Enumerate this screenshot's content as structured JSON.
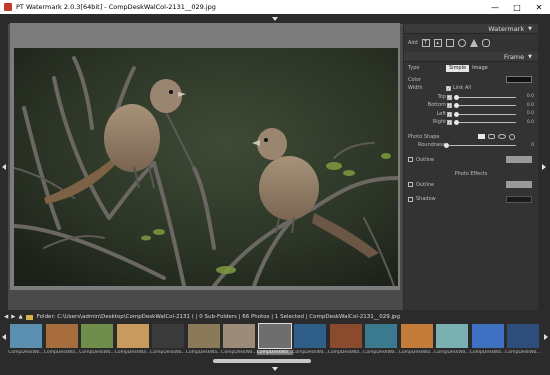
{
  "window": {
    "title": "PT Watermark 2.0.3[64bit] - CompDeskWalCol-2131__029.jpg",
    "controls": [
      "minimize-icon",
      "maximize-icon",
      "close-icon"
    ]
  },
  "panel": {
    "watermark_header": "Watermark",
    "add_label": "Add",
    "add_tools": [
      "text-tool-icon",
      "image-tool-icon",
      "rect-tool-icon",
      "circle-tool-icon",
      "triangle-tool-icon",
      "polygon-tool-icon"
    ],
    "frame_header": "Frame",
    "type_label": "Type",
    "type_simple": "Simple",
    "type_image": "Image",
    "color_label": "Color",
    "width_label": "Width",
    "link_all_label": "Link All",
    "sides": [
      {
        "label": "Top",
        "value": "0.0"
      },
      {
        "label": "Bottom",
        "value": "0.0"
      },
      {
        "label": "Left",
        "value": "0.0"
      },
      {
        "label": "Right",
        "value": "0.0"
      }
    ],
    "photo_shape_label": "Photo Shape",
    "roundness_label": "Roundness",
    "roundness_value": "0",
    "outline_label": "Outline",
    "photo_effects_label": "Photo Effects",
    "effects_outline_label": "Outline",
    "shadow_label": "Shadow"
  },
  "colors": {
    "frame_color": "#111111",
    "outline_color": "#9a9a9a",
    "effects_outline_color": "#9a9a9a",
    "shadow_color": "#1a1a1a"
  },
  "folder_bar": {
    "text": "Folder: C:\\Users\\admin\\Desktop\\CompDeskWalCol-2131 ( | 0 Sub-Folders | 66 Photos | 1 Selected | CompDeskWalCol-2131__029.jpg"
  },
  "thumbnails": [
    {
      "label": "CompDeskWa...",
      "selected": false
    },
    {
      "label": "CompDeskWa...",
      "selected": false
    },
    {
      "label": "CompDeskWa...",
      "selected": false
    },
    {
      "label": "CompDeskWa...",
      "selected": false
    },
    {
      "label": "CompDeskWa...",
      "selected": false
    },
    {
      "label": "CompDeskWa...",
      "selected": false
    },
    {
      "label": "CompDeskWa...",
      "selected": false
    },
    {
      "label": "CompDeskWa...",
      "selected": true
    },
    {
      "label": "CompDeskWa...",
      "selected": false
    },
    {
      "label": "CompDeskWa...",
      "selected": false
    },
    {
      "label": "CompDeskWa...",
      "selected": false
    },
    {
      "label": "CompDeskWa...",
      "selected": false
    },
    {
      "label": "CompDeskWa...",
      "selected": false
    },
    {
      "label": "CompDeskWa...",
      "selected": false
    },
    {
      "label": "CompDeskWa...",
      "selected": false
    }
  ]
}
